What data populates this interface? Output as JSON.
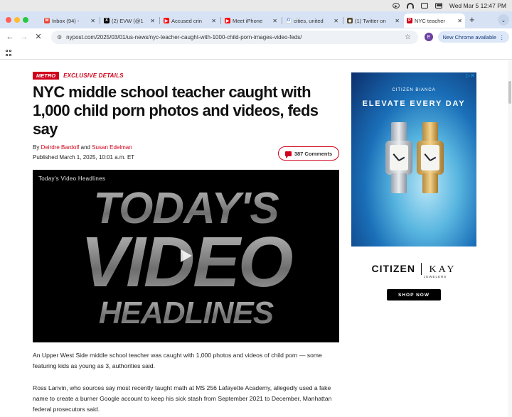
{
  "menubar": {
    "datetime": "Wed Mar 5  12:47 PM"
  },
  "tabs": [
    {
      "label": "Inbox (94) - ",
      "favicon": "gmail-icon",
      "color": "#ea4335",
      "glyph": "M"
    },
    {
      "label": "(2) EVW (@1",
      "favicon": "x-icon",
      "color": "#000000",
      "glyph": "X"
    },
    {
      "label": "Accused crin",
      "favicon": "youtube-icon",
      "color": "#ff0000",
      "glyph": "▶"
    },
    {
      "label": "Meet iPhone",
      "favicon": "youtube-icon",
      "color": "#ff0000",
      "glyph": "▶"
    },
    {
      "label": "cities, united",
      "favicon": "google-icon",
      "color": "#4285f4",
      "glyph": "G"
    },
    {
      "label": "(1) Twitter on",
      "favicon": "site-icon",
      "color": "#5a4a2a",
      "glyph": "◆"
    },
    {
      "label": "NYC teacher",
      "favicon": "nypost-icon",
      "color": "#d0021b",
      "glyph": "P"
    }
  ],
  "toolbar": {
    "url": "nypost.com/2025/03/01/us-news/nyc-teacher-caught-with-1000-child-porn-images-video-feds/",
    "profile_initial": "E",
    "chrome_available": "New Chrome available"
  },
  "article": {
    "section_badge": "METRO",
    "kicker": "EXCLUSIVE DETAILS",
    "headline": "NYC middle school teacher caught with 1,000 child porn photos and videos, feds say",
    "by_prefix": "By",
    "author1": "Deirdre Bardolf",
    "and": "and",
    "author2": "Susan Edelman",
    "published": "Published March 1, 2025, 10:01 a.m. ET",
    "comments": "387 Comments",
    "video_label": "Today's Video Headlines",
    "video_title_1": "TODAY'S",
    "video_title_2": "VIDEO",
    "video_title_3": "HEADLINES",
    "para1": "An Upper West Side middle school teacher was caught with 1,000 photos and videos of child porn — some featuring kids as young as 3, authorities said.",
    "para2": "Ross Lanvin, who sources say most recently taught math at MS 256 Lafayette Academy, allegedly used a fake name to create a burner Google account to keep his sick stash from September 2021 to December, Manhattan federal prosecutors said."
  },
  "ad": {
    "brand_top": "CITIZEN   BIANCA",
    "tagline": "ELEVATE EVERY DAY",
    "brand_citizen": "CITIZEN",
    "brand_kay": "KAY",
    "jewelers": "JEWELERS",
    "cta": "SHOP NOW"
  },
  "colors": {
    "brand_red": "#d0021b",
    "tabstrip": "#d7e3f4"
  }
}
